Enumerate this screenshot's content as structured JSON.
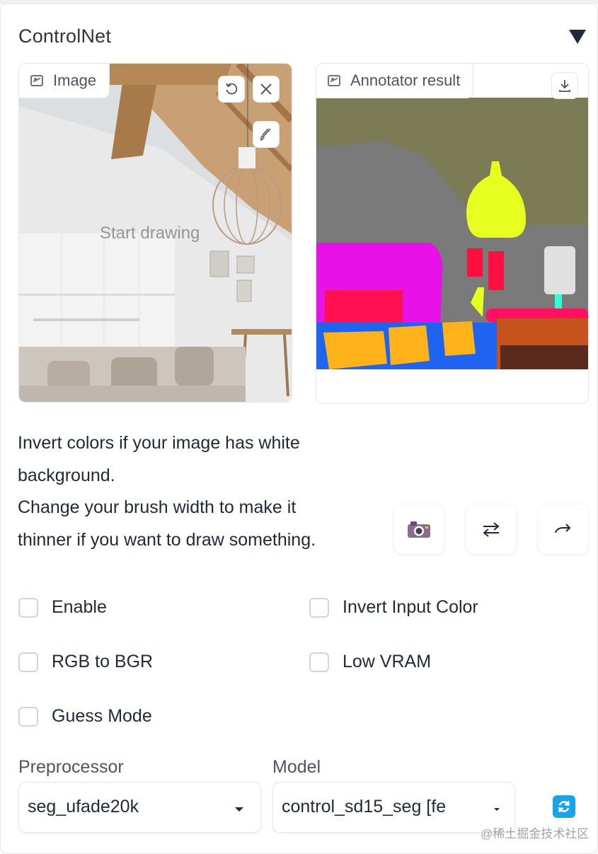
{
  "panel": {
    "title": "ControlNet"
  },
  "image_input": {
    "label": "Image",
    "draw_hint": "Start drawing"
  },
  "annotator": {
    "label": "Annotator result"
  },
  "help_text": [
    "Invert colors if your image has white",
    "background.",
    "Change your brush width to make it",
    "thinner if you want to draw something."
  ],
  "tool_icons": [
    "camera-icon",
    "swap-icon",
    "send-icon"
  ],
  "options": {
    "enable": "Enable",
    "invert_input_color": "Invert Input Color",
    "rgb_to_bgr": "RGB to BGR",
    "low_vram": "Low VRAM",
    "guess_mode": "Guess Mode"
  },
  "preprocessor": {
    "label": "Preprocessor",
    "value": "seg_ufade20k"
  },
  "model": {
    "label": "Model",
    "value": "control_sd15_seg [fe"
  },
  "watermark": "@稀土掘金技术社区",
  "colors": {
    "accent": "#1aa3e8",
    "border": "#e5e7eb"
  }
}
